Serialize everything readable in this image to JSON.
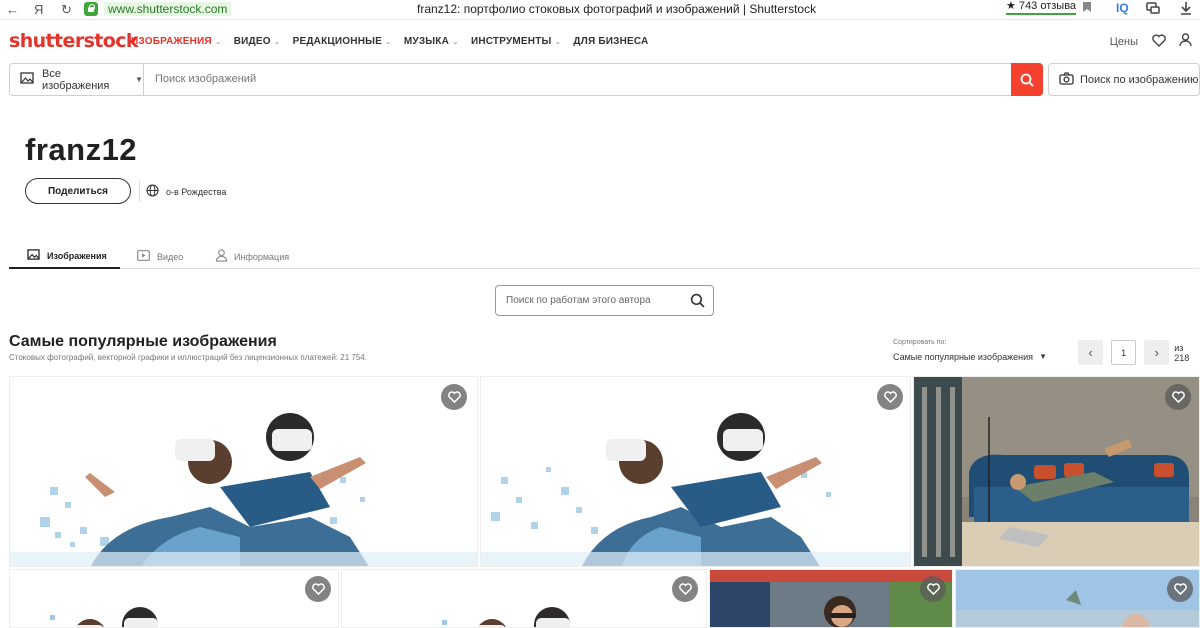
{
  "browser": {
    "url": "www.shutterstock.com",
    "title": "franz12: портфолио стоковых фотографий и изображений | Shutterstock",
    "reviews": "★ 743 отзыва",
    "yandex_icon": "Я",
    "iq_label": "IQ"
  },
  "header": {
    "logo": "shutterstock",
    "menu": [
      {
        "label": "ИЗОБРАЖЕНИЯ",
        "caret": true
      },
      {
        "label": "ВИДЕО",
        "caret": true
      },
      {
        "label": "РЕДАКЦИОННЫЕ",
        "caret": true
      },
      {
        "label": "МУЗЫКА",
        "caret": true
      },
      {
        "label": "ИНСТРУМЕНТЫ",
        "caret": true
      },
      {
        "label": "ДЛЯ БИЗНЕСА",
        "caret": false
      }
    ],
    "prices": "Цены"
  },
  "search": {
    "type_label": "Все изображения",
    "placeholder": "Поиск изображений",
    "image_search": "Поиск по изображению"
  },
  "profile": {
    "username": "franz12",
    "share": "Поделиться",
    "location": "о-в Рождества"
  },
  "tabs": [
    {
      "label": "Изображения"
    },
    {
      "label": "Видео"
    },
    {
      "label": "Информация"
    }
  ],
  "author_search": {
    "placeholder": "Поиск по работам этого автора"
  },
  "section": {
    "title": "Самые популярные изображения",
    "subtitle": "Стоковых фотографий, векторной графики и иллюстраций без лицензионных платежей: 21 754.",
    "sort_label": "Сортировать по:",
    "sort_value": "Самые популярные изображения",
    "page": "1",
    "page_total": "из 218"
  },
  "colors": {
    "brand": "#e4332a",
    "search_button": "#f5412d"
  }
}
